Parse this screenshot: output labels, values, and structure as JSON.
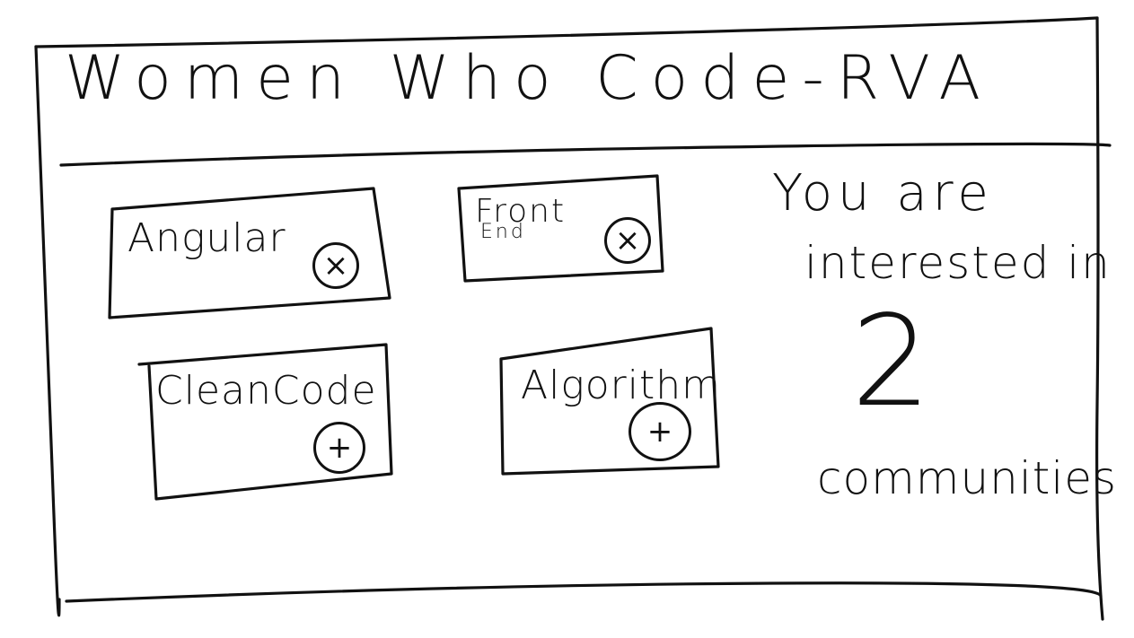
{
  "header": {
    "title": "Women Who Code-RVA"
  },
  "communities": [
    {
      "label_line1": "Angular",
      "label_line2": "",
      "action": "remove",
      "action_symbol": "×"
    },
    {
      "label_line1": "Front",
      "label_line2": "End",
      "action": "remove",
      "action_symbol": "×"
    },
    {
      "label_line1": "CleanCode",
      "label_line2": "",
      "action": "add",
      "action_symbol": "+"
    },
    {
      "label_line1": "Algorithm",
      "label_line2": "",
      "action": "add",
      "action_symbol": "+"
    }
  ],
  "summary": {
    "line1": "You are",
    "line2": "interested in",
    "count": "2",
    "line3": "communities"
  },
  "icons": {
    "remove": "close-circle-icon",
    "add": "plus-circle-icon"
  },
  "colors": {
    "ink": "#111111",
    "background": "#ffffff"
  }
}
